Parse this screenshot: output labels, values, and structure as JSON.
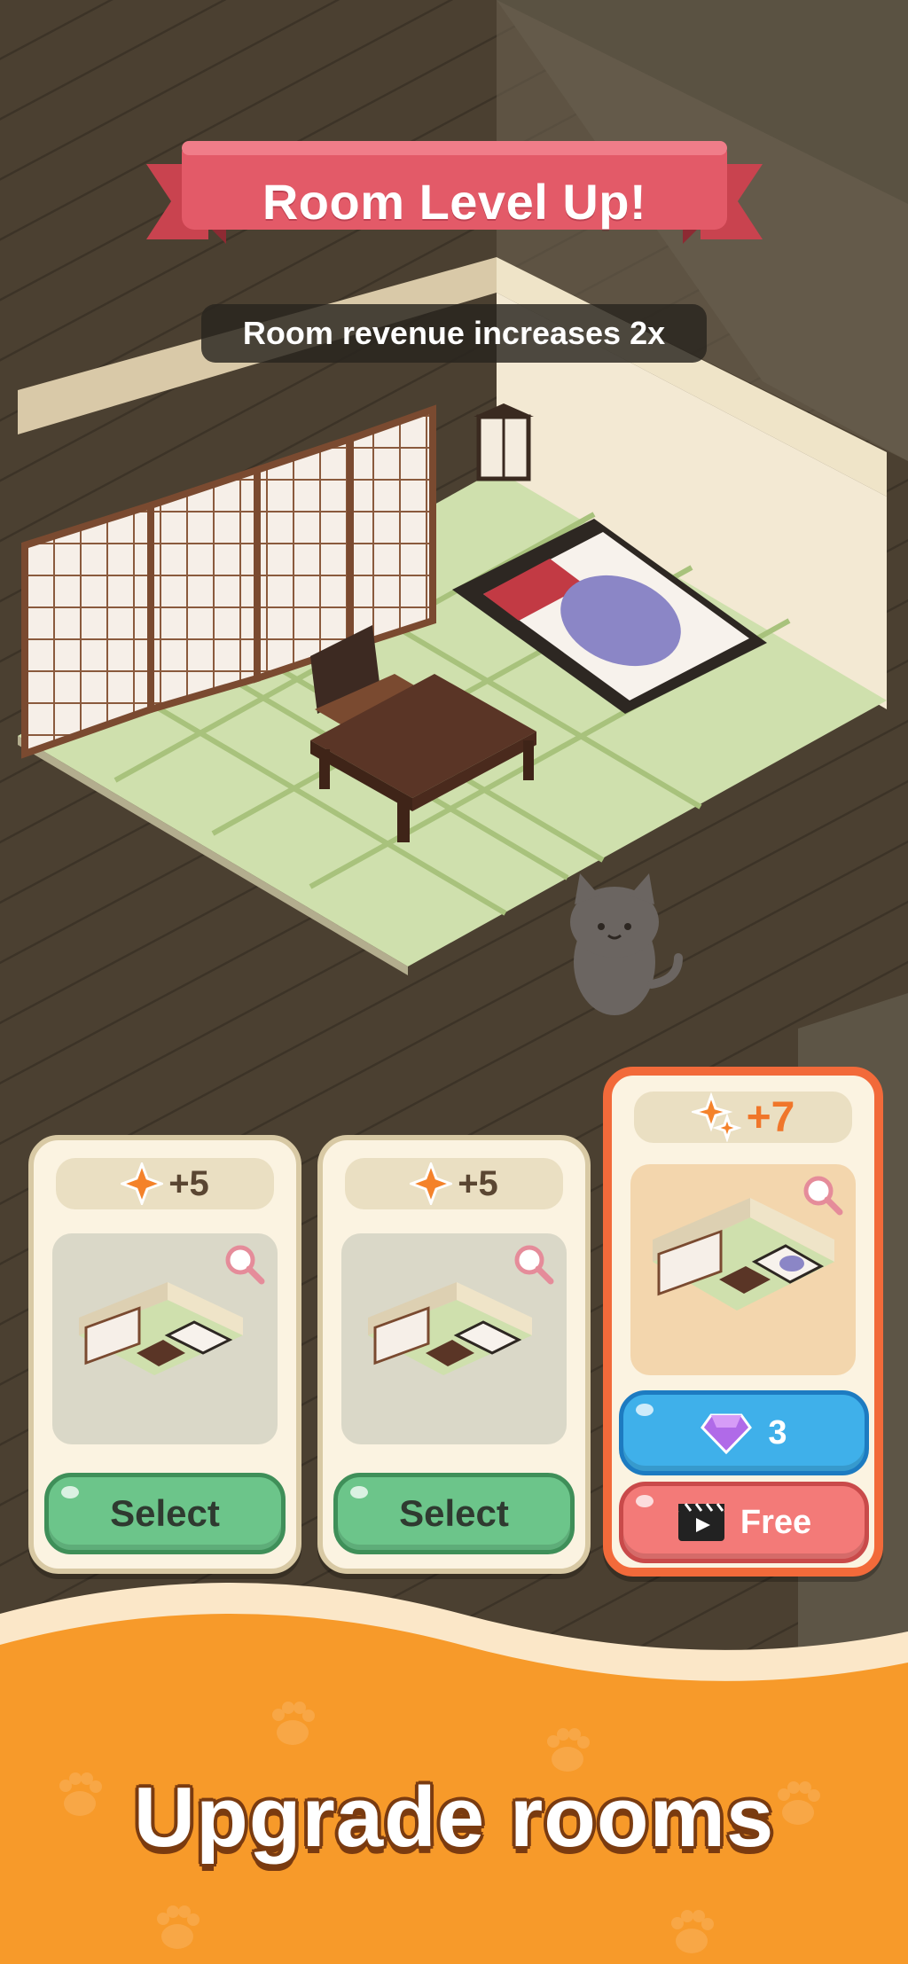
{
  "banner": {
    "title": "Room Level Up!"
  },
  "subtitle": "Room revenue increases 2x",
  "cards": [
    {
      "reward": "+5",
      "button_label": "Select"
    },
    {
      "reward": "+5",
      "button_label": "Select"
    },
    {
      "reward": "+7",
      "gem_cost": "3",
      "free_label": "Free"
    }
  ],
  "footer": {
    "tagline": "Upgrade rooms"
  },
  "colors": {
    "banner": "#e35a68",
    "select_button": "#6cc58a",
    "gem_button": "#3fb0ea",
    "free_button": "#f37a78",
    "premium_border": "#f26a3a",
    "footer": "#f79a2a"
  },
  "icons": [
    "sparkle-icon",
    "magnifier-icon",
    "gem-icon",
    "video-ad-icon",
    "paw-icon"
  ]
}
